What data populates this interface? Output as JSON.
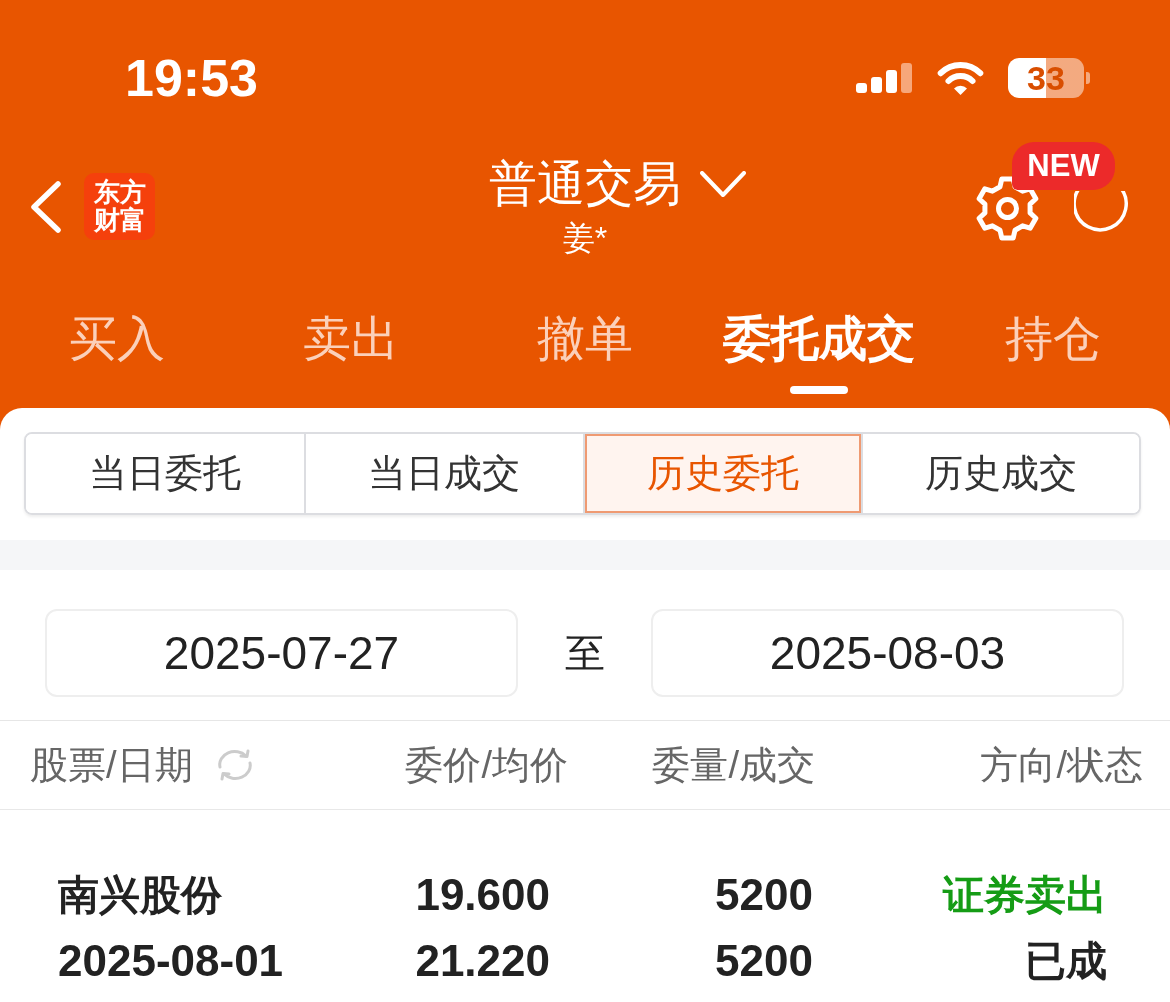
{
  "status_bar": {
    "time": "19:53",
    "battery": "33"
  },
  "header": {
    "logo": "东方财富",
    "title": "普通交易",
    "subtitle": "姜*",
    "badge": "NEW"
  },
  "tabs": [
    {
      "label": "买入",
      "selected": false
    },
    {
      "label": "卖出",
      "selected": false
    },
    {
      "label": "撤单",
      "selected": false
    },
    {
      "label": "委托成交",
      "selected": true
    },
    {
      "label": "持仓",
      "selected": false
    }
  ],
  "sub_tabs": [
    {
      "label": "当日委托",
      "selected": false
    },
    {
      "label": "当日成交",
      "selected": false
    },
    {
      "label": "历史委托",
      "selected": true
    },
    {
      "label": "历史成交",
      "selected": false
    }
  ],
  "date_range": {
    "start": "2025-07-27",
    "separator": "至",
    "end": "2025-08-03"
  },
  "table": {
    "columns": [
      "股票/日期",
      "委价/均价",
      "委量/成交",
      "方向/状态"
    ],
    "rows": [
      {
        "stock": "南兴股份",
        "date": "2025-08-01",
        "order_price": "19.600",
        "avg_price": "21.220",
        "order_qty": "5200",
        "filled_qty": "5200",
        "direction": "证券卖出",
        "color": "#159c15",
        "status": "已成"
      }
    ]
  }
}
